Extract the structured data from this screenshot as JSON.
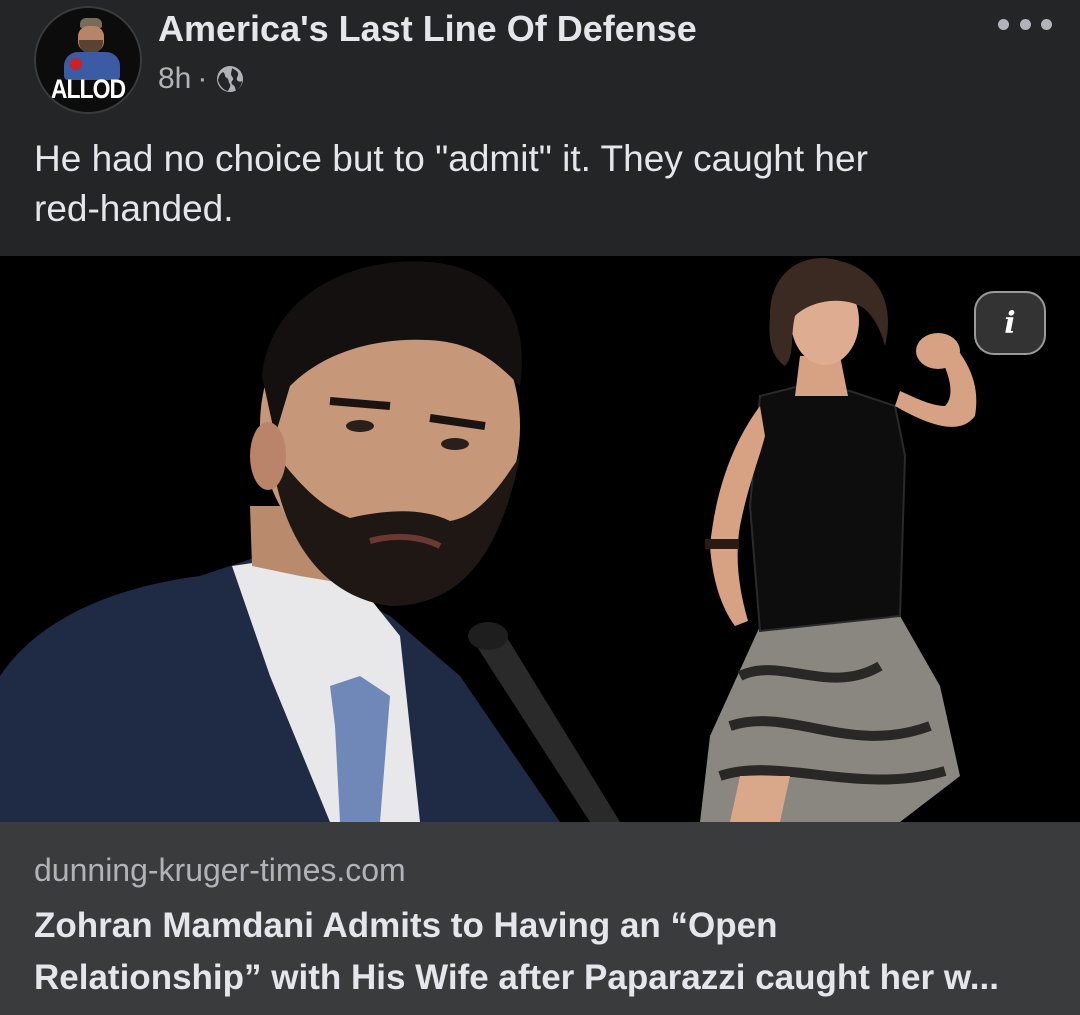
{
  "post": {
    "page_name": "America's Last Line Of Defense",
    "avatar_text": "ALLOD",
    "time": "8h",
    "separator": "·",
    "audience_icon": "globe-icon",
    "more_icon": "more-horizontal-icon",
    "text_line1": "He had no choice but to \"admit\" it. They caught her",
    "text_line2": "red-handed."
  },
  "media": {
    "info_label": "i",
    "info_icon": "info-icon"
  },
  "link": {
    "domain": "dunning-kruger-times.com",
    "title_line1": "Zohran Mamdani Admits to Having an “Open",
    "title_line2": "Relationship” with His Wife after Paparazzi caught her w..."
  },
  "colors": {
    "background": "#242526",
    "footer_background": "#3a3b3c",
    "primary_text": "#e4e6eb",
    "secondary_text": "#b0b3b8",
    "media_background": "#000000"
  }
}
